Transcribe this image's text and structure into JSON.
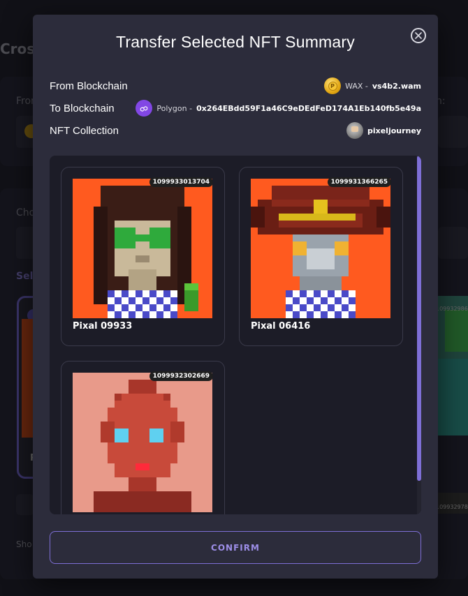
{
  "background": {
    "page_title": "Cross",
    "from_label": "From",
    "to_label": "n:",
    "choose_label": "Cho",
    "selected_label": "Sele",
    "partial_nft_label": "P",
    "partial_nft_id": "1099329860",
    "partial_nft_id2": "1099329786",
    "show_label": "Sho"
  },
  "modal": {
    "title": "Transfer Selected NFT Summary",
    "close_icon": "close-circle-icon",
    "from": {
      "label": "From Blockchain",
      "icon": "wax-coin-icon",
      "chain": "WAX -",
      "account": "vs4b2.wam"
    },
    "to": {
      "label": "To Blockchain",
      "icon": "polygon-icon",
      "chain": "Polygon -",
      "address": "0x264EBdd59F1a46C9eDEdFeD174A1Eb140fb5e49a"
    },
    "collection": {
      "label": "NFT Collection",
      "icon": "pixeljourney-avatar-icon",
      "name": "pixeljourney"
    },
    "nfts": [
      {
        "id": "1099933013704",
        "name": "Pixal 09933",
        "art": "woman-with-green-glasses"
      },
      {
        "id": "1099931366265",
        "name": "Pixal 06416",
        "art": "robot-with-red-hat"
      },
      {
        "id": "1099932302669",
        "name": "",
        "art": "red-pixel-face"
      }
    ],
    "confirm_label": "CONFIRM"
  },
  "colors": {
    "accent": "#7e6fd6",
    "modal_bg": "#2c2c3b",
    "gallery_bg": "#1c1c27",
    "art_orange": "#ff5a1f",
    "polygon_purple": "#8247e5"
  }
}
